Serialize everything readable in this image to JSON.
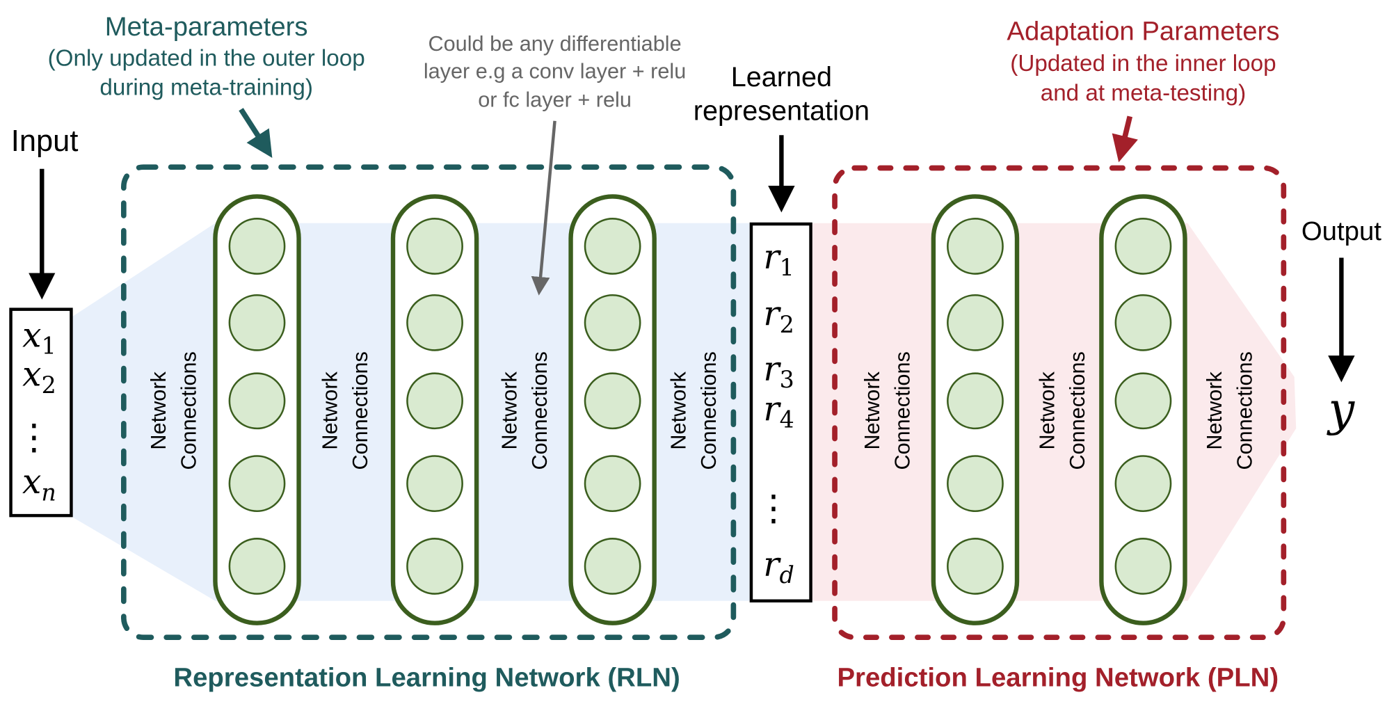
{
  "colors": {
    "rln": "#1f5b5d",
    "pln": "#a3202a",
    "neuron_stroke": "#3b5e1e",
    "neuron_fill": "#d9ead0",
    "rln_shade": "#e8f0fb",
    "pln_shade": "#fbeaec"
  },
  "input": {
    "label": "Input",
    "items": [
      {
        "var": "x",
        "sub": "1"
      },
      {
        "var": "x",
        "sub": "2"
      },
      {
        "var": "x",
        "sub": "n"
      }
    ],
    "ellipsis": "⋮"
  },
  "meta": {
    "line1": "Meta-parameters",
    "line2": "(Only updated in the outer loop",
    "line3": "during meta-training)"
  },
  "note": {
    "line1": "Could be any differentiable",
    "line2": "layer e.g a conv layer + relu",
    "line3": "or fc layer + relu"
  },
  "learned": {
    "line1": "Learned",
    "line2": "representation",
    "items": [
      {
        "var": "r",
        "sub": "1"
      },
      {
        "var": "r",
        "sub": "2"
      },
      {
        "var": "r",
        "sub": "3"
      },
      {
        "var": "r",
        "sub": "4"
      },
      {
        "var": "r",
        "sub": "d"
      }
    ],
    "ellipsis": "⋮"
  },
  "adapt": {
    "line1": "Adaptation Parameters",
    "line2": "(Updated in the inner loop",
    "line3": "and at meta-testing)"
  },
  "output": {
    "label": "Output",
    "var": "y"
  },
  "connections": {
    "line1": "Network",
    "line2": "Connections"
  },
  "rln_title": "Representation Learning Network (RLN)",
  "pln_title": "Prediction Learning Network (PLN)"
}
